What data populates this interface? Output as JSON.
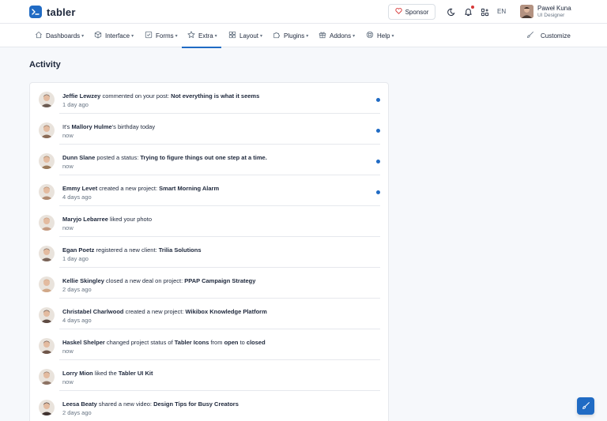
{
  "brand": {
    "name": "tabler",
    "accent": "#206bc4"
  },
  "topbar": {
    "sponsor_label": "Sponsor",
    "language": "EN",
    "user": {
      "name": "Paweł Kuna",
      "role": "UI Designer"
    }
  },
  "nav": [
    {
      "label": "Dashboards",
      "icon": "home-icon"
    },
    {
      "label": "Interface",
      "icon": "package-icon"
    },
    {
      "label": "Forms",
      "icon": "checkbox-icon"
    },
    {
      "label": "Extra",
      "icon": "star-icon",
      "active": true
    },
    {
      "label": "Layout",
      "icon": "layout-icon"
    },
    {
      "label": "Plugins",
      "icon": "puzzle-icon"
    },
    {
      "label": "Addons",
      "icon": "gift-icon"
    },
    {
      "label": "Help",
      "icon": "lifebuoy-icon"
    }
  ],
  "customize_label": "Customize",
  "page_title": "Activity",
  "activity": [
    {
      "parts": [
        "Jeffie Lewzey",
        " commented on your post: ",
        "Not everything is what it seems",
        ""
      ],
      "time": "1 day ago",
      "unread": true,
      "avatar_color": "#6b5b52"
    },
    {
      "parts": [
        "",
        "It's ",
        "Mallory Hulme",
        "'s birthday today"
      ],
      "time": "now",
      "unread": true,
      "avatar_color": "#8a6a55"
    },
    {
      "parts": [
        "Dunn Slane",
        " posted a status: ",
        "Trying to figure things out one step at a time.",
        ""
      ],
      "time": "now",
      "unread": true,
      "avatar_color": "#9a7a5a"
    },
    {
      "parts": [
        "Emmy Levet",
        " created a new project: ",
        "Smart Morning Alarm",
        ""
      ],
      "time": "4 days ago",
      "unread": true,
      "avatar_color": "#b08a70"
    },
    {
      "parts": [
        "Maryjo Lebarree",
        " liked your photo",
        "",
        ""
      ],
      "time": "now",
      "unread": false,
      "avatar_color": "#c49a80"
    },
    {
      "parts": [
        "Egan Poetz",
        " registered a new client: ",
        "Trilia Solutions",
        ""
      ],
      "time": "1 day ago",
      "unread": false,
      "avatar_color": "#7a6458"
    },
    {
      "parts": [
        "Kellie Skingley",
        " closed a new deal on project: ",
        "PPAP Campaign Strategy",
        ""
      ],
      "time": "2 days ago",
      "unread": false,
      "avatar_color": "#d1a888"
    },
    {
      "parts": [
        "Christabel Charlwood",
        " created a new project: ",
        "Wikibox Knowledge Platform",
        ""
      ],
      "time": "4 days ago",
      "unread": false,
      "avatar_color": "#5e4a42"
    },
    {
      "parts": [
        "Haskel Shelper",
        " changed project status of ",
        "Tabler Icons",
        " from ",
        "open",
        " to ",
        "closed"
      ],
      "time": "now",
      "unread": false,
      "avatar_color": "#6e5549"
    },
    {
      "parts": [
        "Lorry Mion",
        " liked the ",
        "Tabler UI Kit",
        ""
      ],
      "time": "now",
      "unread": false,
      "avatar_color": "#8c7263"
    },
    {
      "parts": [
        "Leesa Beaty",
        " shared a new video: ",
        "Design Tips for Busy Creators",
        ""
      ],
      "time": "2 days ago",
      "unread": false,
      "avatar_color": "#3f322e"
    }
  ]
}
